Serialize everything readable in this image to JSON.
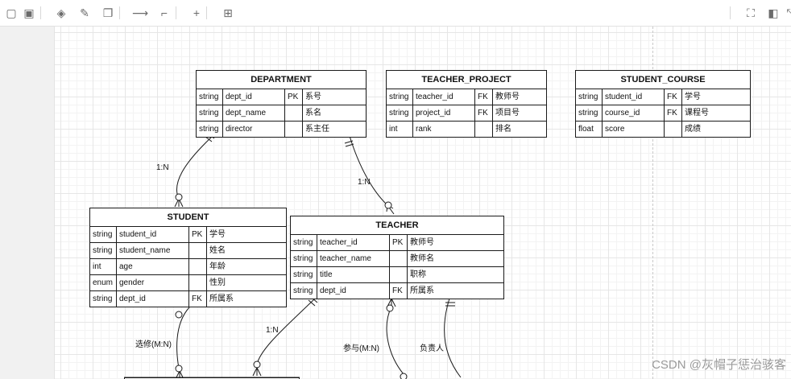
{
  "toolbar": {
    "items": [
      {
        "name": "to-front-icon",
        "glyph": "▢"
      },
      {
        "name": "to-back-icon",
        "glyph": "▣"
      },
      {
        "name": "fill-color-icon",
        "glyph": "◈"
      },
      {
        "name": "line-color-icon",
        "glyph": "✎"
      },
      {
        "name": "shadow-icon",
        "glyph": "❐"
      },
      {
        "name": "connection-icon",
        "glyph": "⟶"
      },
      {
        "name": "waypoints-icon",
        "glyph": "⌐"
      },
      {
        "name": "insert-icon",
        "glyph": "+"
      },
      {
        "name": "table-icon",
        "glyph": "⊞"
      },
      {
        "name": "fullscreen-icon",
        "glyph": "⛶"
      },
      {
        "name": "format-panel-icon",
        "glyph": "◧"
      },
      {
        "name": "collapse-icon",
        "glyph": "⤡"
      }
    ]
  },
  "entities": [
    {
      "id": "department",
      "title": "DEPARTMENT",
      "rows": [
        [
          "string",
          "dept_id",
          "PK",
          "系号"
        ],
        [
          "string",
          "dept_name",
          "",
          "系名"
        ],
        [
          "string",
          "director",
          "",
          "系主任"
        ]
      ]
    },
    {
      "id": "teacher-project",
      "title": "TEACHER_PROJECT",
      "rows": [
        [
          "string",
          "teacher_id",
          "FK",
          "教师号"
        ],
        [
          "string",
          "project_id",
          "FK",
          "项目号"
        ],
        [
          "int",
          "rank",
          "",
          "排名"
        ]
      ]
    },
    {
      "id": "student-course",
      "title": "STUDENT_COURSE",
      "rows": [
        [
          "string",
          "student_id",
          "FK",
          "学号"
        ],
        [
          "string",
          "course_id",
          "FK",
          "课程号"
        ],
        [
          "float",
          "score",
          "",
          "成绩"
        ]
      ]
    },
    {
      "id": "student",
      "title": "STUDENT",
      "rows": [
        [
          "string",
          "student_id",
          "PK",
          "学号"
        ],
        [
          "string",
          "student_name",
          "",
          "姓名"
        ],
        [
          "int",
          "age",
          "",
          "年龄"
        ],
        [
          "enum",
          "gender",
          "",
          "性别"
        ],
        [
          "string",
          "dept_id",
          "FK",
          "所属系"
        ]
      ]
    },
    {
      "id": "teacher",
      "title": "TEACHER",
      "rows": [
        [
          "string",
          "teacher_id",
          "PK",
          "教师号"
        ],
        [
          "string",
          "teacher_name",
          "",
          "教师名"
        ],
        [
          "string",
          "title",
          "",
          "职称"
        ],
        [
          "string",
          "dept_id",
          "FK",
          "所属系"
        ]
      ]
    }
  ],
  "edge_labels": {
    "dept_student": "1:N",
    "dept_teacher": "1:N",
    "student_course": "选修(M:N)",
    "teacher_lower": "1:N",
    "teacher_project": "参与(M:N)",
    "teacher_lead": "负责人"
  },
  "watermark": "CSDN @灰帽子惩治骇客",
  "colors": {
    "line": "#1a1a1a",
    "grid": "#e6e6e6",
    "panel": "#f1f1f1"
  }
}
